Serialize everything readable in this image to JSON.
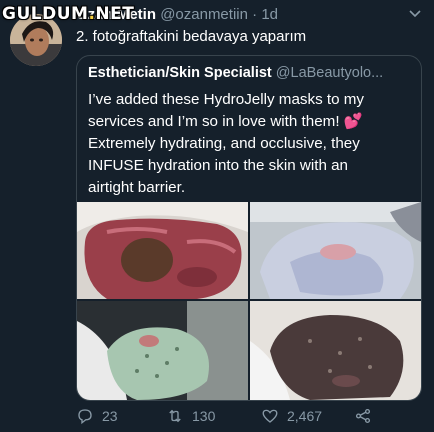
{
  "watermark": {
    "text_left": "GULDUM",
    "text_dot": ".",
    "text_right": "NET"
  },
  "tweet": {
    "author_name": "Ozan Metin",
    "author_handle": "@ozanmetiin",
    "separator": "·",
    "time": "1d",
    "text": "2. fotoğraftakini bedavaya yaparım"
  },
  "quote": {
    "author_name": "Esthetician/Skin Specialist",
    "author_handle": "@LaBeautyolo...",
    "text_line1": "I’ve added these HydroJelly masks to my",
    "text_line2": "services and I’m so in love with them!",
    "emoji": "💕",
    "text_line3": "Extremely hydrating, and occlusive, they",
    "text_line4": "INFUSE hydration into the skin with an",
    "text_line5": "airtight barrier."
  },
  "actions": {
    "replies": "23",
    "retweets": "130",
    "likes": "2,467"
  },
  "icons": {
    "reply": "reply-icon",
    "retweet": "retweet-icon",
    "like": "heart-icon",
    "share": "share-icon",
    "more": "chevron-down-icon"
  },
  "colors": {
    "background": "#15202b",
    "secondary_text": "#8899a6",
    "border": "#38444d",
    "heart": "#e0245e"
  }
}
